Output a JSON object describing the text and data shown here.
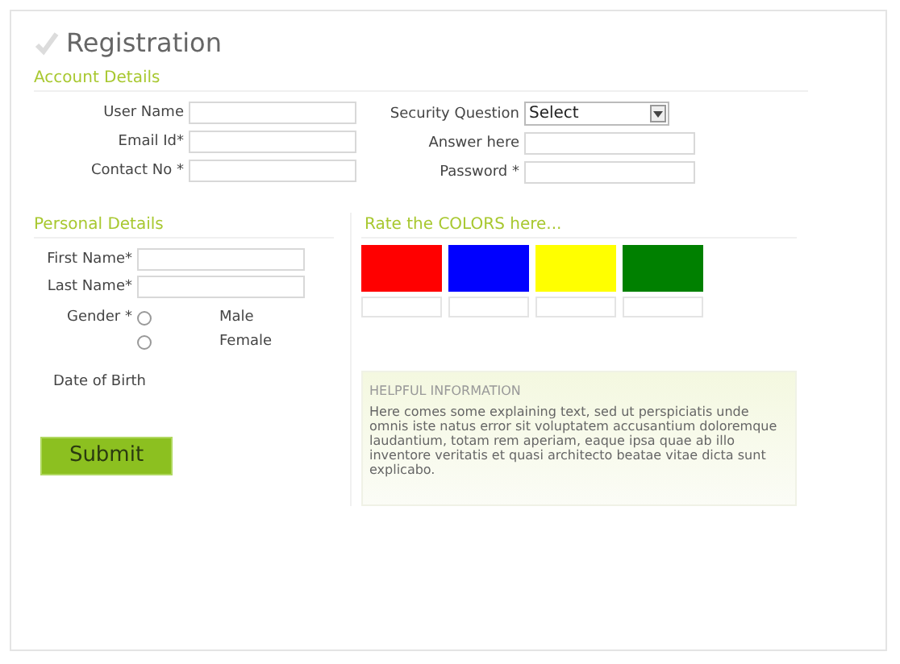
{
  "title": "Registration",
  "account": {
    "heading": "Account Details",
    "left": [
      {
        "label": "User Name"
      },
      {
        "label": "Email Id*"
      },
      {
        "label": "Contact No *"
      }
    ],
    "security": {
      "label": "Security Question",
      "value": "Select"
    },
    "right": [
      {
        "label": "Answer here"
      },
      {
        "label": "Password *"
      }
    ]
  },
  "personal": {
    "heading": "Personal Details",
    "fields": [
      {
        "label": "First Name*"
      },
      {
        "label": "Last Name*"
      }
    ],
    "gender": {
      "label": "Gender *",
      "options": [
        {
          "label": "Male",
          "selected": false
        },
        {
          "label": "Female",
          "selected": false
        }
      ]
    },
    "dob": "Date of Birth"
  },
  "submit": "Submit",
  "rate": {
    "heading": "Rate the COLORS here...",
    "swatches": [
      {
        "color": "#ff0000"
      },
      {
        "color": "#0000ff"
      },
      {
        "color": "#ffff00"
      },
      {
        "color": "#008000"
      }
    ]
  },
  "help": {
    "heading": "HELPFUL INFORMATION",
    "text": "Here comes some explaining text, sed ut perspiciatis unde omnis iste natus error sit voluptatem accusantium doloremque laudantium, totam rem aperiam, eaque ipsa quae ab illo inventore veritatis et quasi architecto beatae vitae dicta sunt explicabo."
  }
}
